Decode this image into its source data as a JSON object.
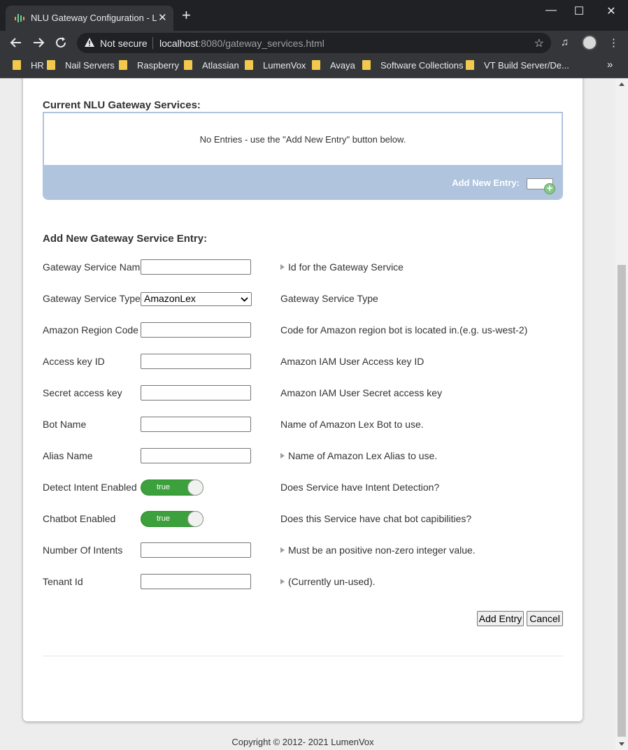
{
  "browser": {
    "tab_title": "NLU Gateway Configuration - Lu",
    "tab_close": "✕",
    "new_tab": "+",
    "security_label": "Not secure",
    "url_host": "localhost",
    "url_path": ":8080/gateway_services.html",
    "window": {
      "minimize": "—",
      "maximize": "☐",
      "close": "✕"
    }
  },
  "bookmarks": [
    {
      "label": "HR"
    },
    {
      "label": "Nail Servers"
    },
    {
      "label": "Raspberry"
    },
    {
      "label": "Atlassian"
    },
    {
      "label": "LumenVox"
    },
    {
      "label": "Avaya"
    },
    {
      "label": "Software Collections"
    },
    {
      "label": "VT Build Server/De..."
    }
  ],
  "bookmarks_more": "»",
  "page": {
    "current_title": "Current NLU Gateway Services:",
    "no_entries": "No Entries - use the \"Add New Entry\" button below.",
    "add_new_entry_label": "Add New Entry:",
    "add_title": "Add New Gateway Service Entry:",
    "fields": [
      {
        "label": "Gateway Service Name",
        "type": "input",
        "value": "",
        "help": "Id for the Gateway Service",
        "triangle": true
      },
      {
        "label": "Gateway Service Type",
        "type": "select",
        "value": "AmazonLex",
        "help": "Gateway Service Type",
        "triangle": false
      },
      {
        "label": "Amazon Region Code",
        "type": "input",
        "value": "",
        "help": "Code for Amazon region bot is located in.(e.g. us-west-2)",
        "triangle": false
      },
      {
        "label": "Access key ID",
        "type": "input",
        "value": "",
        "help": "Amazon IAM User Access key ID",
        "triangle": false
      },
      {
        "label": "Secret access key",
        "type": "input",
        "value": "",
        "help": "Amazon IAM User Secret access key",
        "triangle": false
      },
      {
        "label": "Bot Name",
        "type": "input",
        "value": "",
        "help": "Name of Amazon Lex Bot to use.",
        "triangle": false
      },
      {
        "label": "Alias Name",
        "type": "input",
        "value": "",
        "help": "Name of Amazon Lex Alias to use.",
        "triangle": true
      },
      {
        "label": "Detect Intent Enabled",
        "type": "toggle",
        "value": "true",
        "help": "Does Service have Intent Detection?",
        "triangle": false
      },
      {
        "label": "Chatbot Enabled",
        "type": "toggle",
        "value": "true",
        "help": "Does this Service have chat bot capibilities?",
        "triangle": false
      },
      {
        "label": "Number Of Intents",
        "type": "input",
        "value": "",
        "help": "Must be an positive non-zero integer value.",
        "triangle": true
      },
      {
        "label": "Tenant Id",
        "type": "input",
        "value": "",
        "help": "(Currently un-used).",
        "triangle": true
      }
    ],
    "add_button": "Add Entry",
    "cancel_button": "Cancel",
    "copyright": "Copyright © 2012- 2021 LumenVox"
  },
  "colors": {
    "panel_blue": "#b0c4de",
    "toggle_green": "#3ca03c",
    "chrome_dark": "#202124",
    "chrome_toolbar": "#35363a"
  }
}
